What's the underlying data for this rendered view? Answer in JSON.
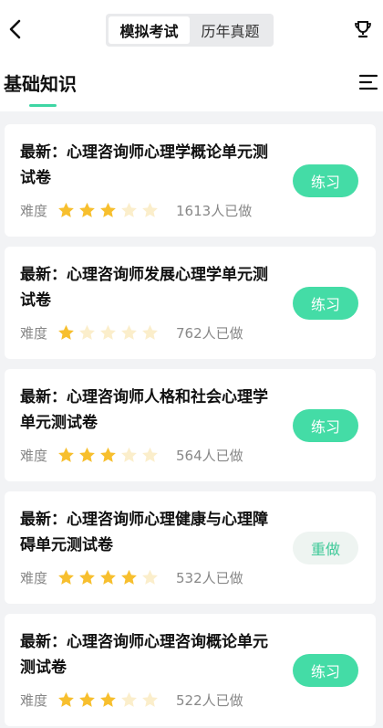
{
  "header": {
    "tabs": [
      {
        "label": "模拟考试",
        "active": true
      },
      {
        "label": "历年真题",
        "active": false
      }
    ],
    "back_icon": "chevron-left-icon",
    "trophy_icon": "trophy-icon"
  },
  "category": {
    "title": "基础知识",
    "accent": "#3ed6a4",
    "menu_icon": "list-menu-icon"
  },
  "items": [
    {
      "title": "最新：心理咨询师心理学概论单元测试卷",
      "difficulty_label": "难度",
      "rating": 3,
      "max_rating": 5,
      "count": "1613人已做",
      "action": "练习",
      "action_style": "primary"
    },
    {
      "title": "最新：心理咨询师发展心理学单元测试卷",
      "difficulty_label": "难度",
      "rating": 1,
      "max_rating": 5,
      "count": "762人已做",
      "action": "练习",
      "action_style": "primary"
    },
    {
      "title": "最新：心理咨询师人格和社会心理学单元测试卷",
      "difficulty_label": "难度",
      "rating": 3,
      "max_rating": 5,
      "count": "564人已做",
      "action": "练习",
      "action_style": "primary"
    },
    {
      "title": "最新：心理咨询师心理健康与心理障碍单元测试卷",
      "difficulty_label": "难度",
      "rating": 4,
      "max_rating": 5,
      "count": "532人已做",
      "action": "重做",
      "action_style": "secondary"
    },
    {
      "title": "最新：心理咨询师心理咨询概论单元测试卷",
      "difficulty_label": "难度",
      "rating": 3,
      "max_rating": 5,
      "count": "522人已做",
      "action": "练习",
      "action_style": "primary"
    }
  ],
  "colors": {
    "star_on": "#f7bf2e",
    "star_off": "#fbeecb",
    "primary": "#44dca6"
  }
}
